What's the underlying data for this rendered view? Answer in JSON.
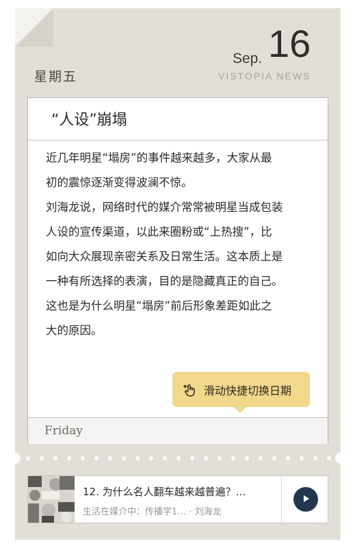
{
  "header": {
    "weekday_cn": "星期五",
    "month": "Sep.",
    "day": "16",
    "brand": "VISTOPIA NEWS"
  },
  "card": {
    "title": "“人设”崩塌",
    "lines": [
      "近几年明星“塌房”的事件越来越多，大家从最",
      "初的震惊逐渐变得波澜不惊。",
      "刘海龙说，网络时代的媒介常常被明星当成包装",
      "人设的宣传渠道，以此来圈粉或“上热搜”，比",
      "如向大众展现亲密关系及日常生活。这本质上是",
      "一种有所选择的表演，目的是隐藏真正的自己。",
      "这也是为什么明星“塌房”前后形象差距如此之",
      "大的原因。"
    ],
    "tip_label": "滑动快捷切换日期",
    "tip_icon": "swipe-hand-icon",
    "footer_day": "Friday"
  },
  "player": {
    "title": "12. 为什么名人翻车越来越普遍？…",
    "subtitle": "生活在媒介中：传播学1… · 刘海龙",
    "play_icon": "play-icon"
  },
  "colors": {
    "background": "#e2dfd8",
    "tip": "#f2d88a",
    "play_button": "#23364f"
  }
}
